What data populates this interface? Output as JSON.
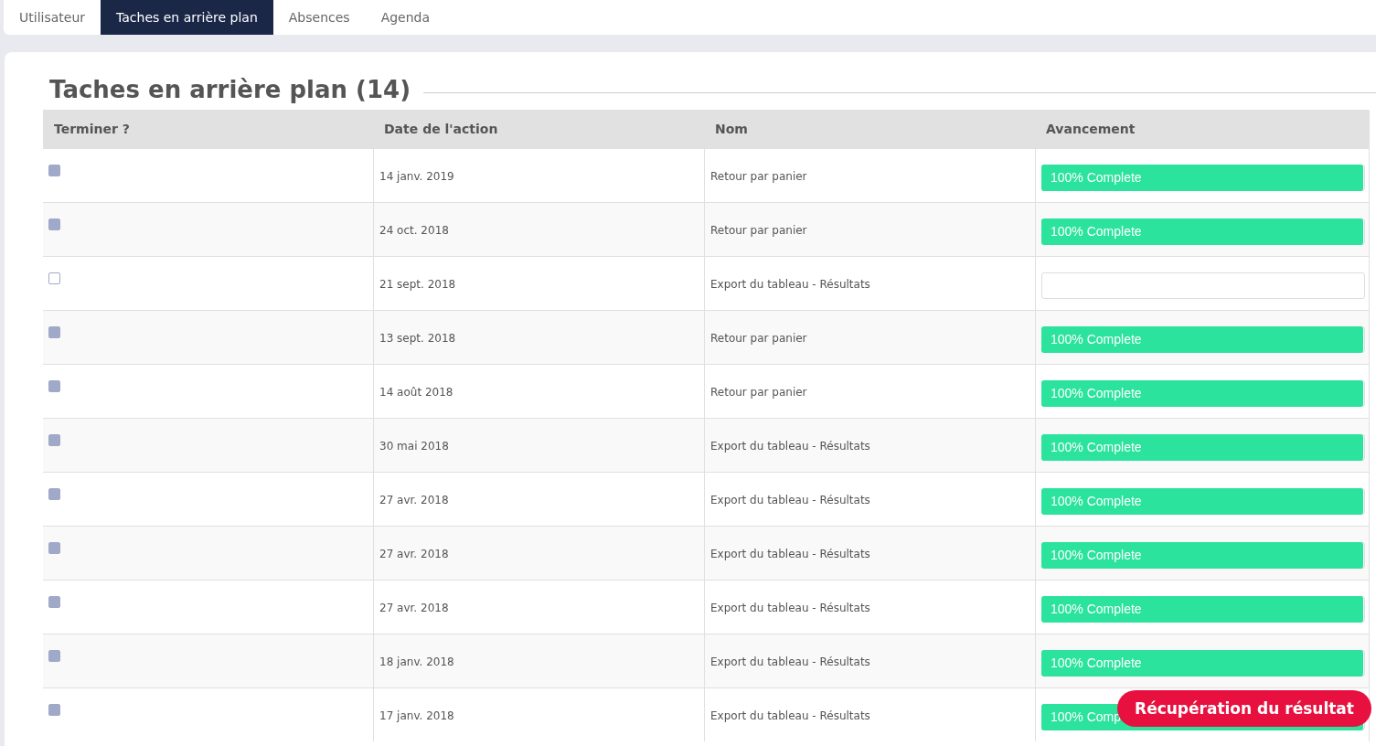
{
  "tabs": [
    {
      "label": "Utilisateur",
      "selected": false
    },
    {
      "label": "Taches en arrière plan",
      "selected": true
    },
    {
      "label": "Absences",
      "selected": false
    },
    {
      "label": "Agenda",
      "selected": false
    }
  ],
  "title": "Taches en arrière plan (14)",
  "table": {
    "columns": [
      "Terminer ?",
      "Date de l'action",
      "Nom",
      "Avancement"
    ],
    "rows": [
      {
        "checked": true,
        "date": "14 janv. 2019",
        "name": "Retour par panier",
        "level": 1,
        "progress_label": "100% Complete"
      },
      {
        "checked": true,
        "date": "24 oct. 2018",
        "name": "Retour par panier",
        "level": 1,
        "progress_label": "100% Complete"
      },
      {
        "checked": false,
        "date": "21 sept. 2018",
        "name": "Export du tableau - Résultats",
        "level": 0
      },
      {
        "checked": true,
        "date": "13 sept. 2018",
        "name": "Retour par panier",
        "level": 1,
        "progress_label": "100% Complete"
      },
      {
        "checked": true,
        "date": "14 août 2018",
        "name": "Retour par panier",
        "level": 1,
        "progress_label": "100% Complete"
      },
      {
        "checked": true,
        "date": "30 mai 2018",
        "name": "Export du tableau - Résultats",
        "level": 1,
        "progress_label": "100% Complete"
      },
      {
        "checked": true,
        "date": "27 avr. 2018",
        "name": "Export du tableau - Résultats",
        "level": 1,
        "progress_label": "100% Complete"
      },
      {
        "checked": true,
        "date": "27 avr. 2018",
        "name": "Export du tableau - Résultats",
        "level": 1,
        "progress_label": "100% Complete"
      },
      {
        "checked": true,
        "date": "27 avr. 2018",
        "name": "Export du tableau - Résultats",
        "level": 1,
        "progress_label": "100% Complete"
      },
      {
        "checked": true,
        "date": "18 janv. 2018",
        "name": "Export du tableau - Résultats",
        "level": 1,
        "progress_label": "100% Complete"
      },
      {
        "checked": true,
        "date": "17 janv. 2018",
        "name": "Export du tableau - Résultats",
        "level": 1,
        "progress_label": "100% Comp"
      }
    ]
  },
  "toast": "Récupération du résultat"
}
